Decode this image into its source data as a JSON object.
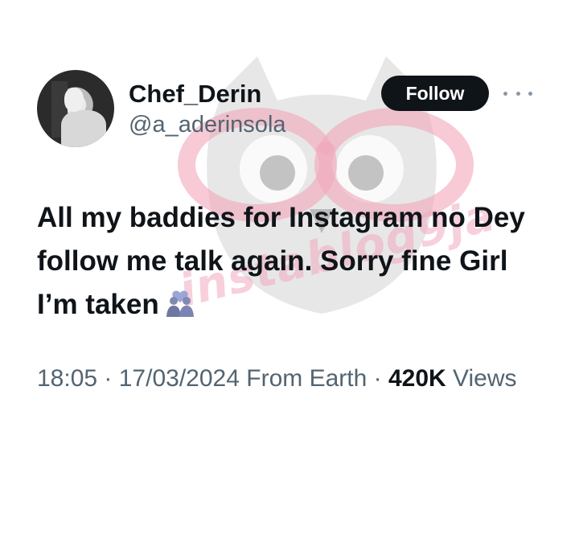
{
  "watermark": {
    "text": "instablog9ja",
    "logo": "owl-glasses-icon",
    "color": "#f0aabe"
  },
  "user": {
    "display_name": "Chef_Derin",
    "handle": "@a_aderinsola",
    "avatar": "avatar"
  },
  "header": {
    "follow_label": "Follow",
    "more_icon": "more-horizontal-icon"
  },
  "tweet": {
    "text": "All my baddies for Instagram no Dey follow me talk again. Sorry fine Girl I’m taken",
    "emoji": "couple-with-heart-icon"
  },
  "meta": {
    "time": "18:05",
    "separator": " · ",
    "date": "17/03/2024",
    "source": "From Earth",
    "views_count": "420K",
    "views_label": "Views"
  },
  "colors": {
    "text_primary": "#0f1419",
    "text_secondary": "#536471",
    "button_bg": "#0f1419",
    "button_text": "#ffffff"
  }
}
